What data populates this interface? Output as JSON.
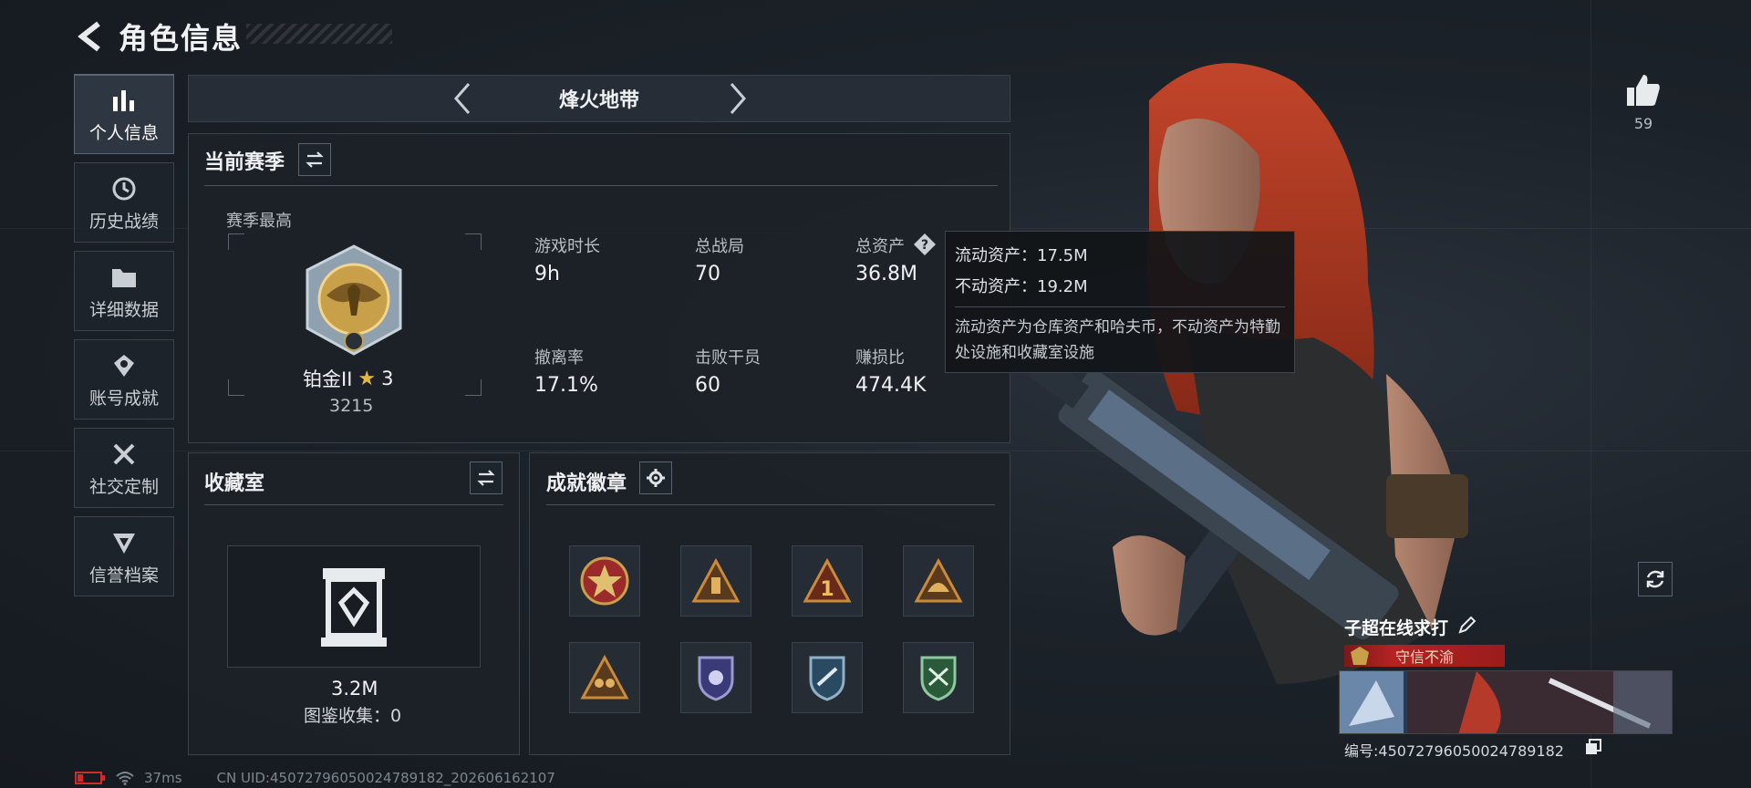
{
  "header": {
    "title": "角色信息"
  },
  "sidebar": {
    "items": [
      {
        "label": "个人信息",
        "icon": "bar-chart-icon"
      },
      {
        "label": "历史战绩",
        "icon": "history-icon"
      },
      {
        "label": "详细数据",
        "icon": "folder-icon"
      },
      {
        "label": "账号成就",
        "icon": "achievement-icon"
      },
      {
        "label": "社交定制",
        "icon": "tools-icon"
      },
      {
        "label": "信誉档案",
        "icon": "reputation-icon"
      }
    ]
  },
  "mode": {
    "title": "烽火地带"
  },
  "season": {
    "title": "当前赛季",
    "best_label": "赛季最高",
    "rank": "铂金II",
    "stars": "3",
    "score": "3215",
    "stats": [
      {
        "label": "游戏时长",
        "value": "9h"
      },
      {
        "label": "总战局",
        "value": "70"
      },
      {
        "label": "总资产",
        "value": "36.8M"
      },
      {
        "label": "撤离率",
        "value": "17.1%"
      },
      {
        "label": "击败干员",
        "value": "60"
      },
      {
        "label": "赚损比",
        "value": "474.4K"
      }
    ]
  },
  "tooltip": {
    "liquid": "流动资产：17.5M",
    "fixed": "不动资产：19.2M",
    "desc": "流动资产为仓库资产和哈夫币，不动资产为特勤处设施和收藏室设施"
  },
  "collection": {
    "title": "收藏室",
    "value": "3.2M",
    "catalog": "图鉴收集：0"
  },
  "badges": {
    "title": "成就徽章"
  },
  "profile": {
    "likes": "59",
    "name": "子超在线求打",
    "title_tag": "守信不渝",
    "id": "编号:450727960500247891​82"
  },
  "status": {
    "ping": "37ms",
    "uid": "CN UID:45072796050024789182_202606162107"
  },
  "colors": {
    "accent": "#4ad59a",
    "tag_red": "#b52222",
    "gold": "#c9a04a"
  }
}
